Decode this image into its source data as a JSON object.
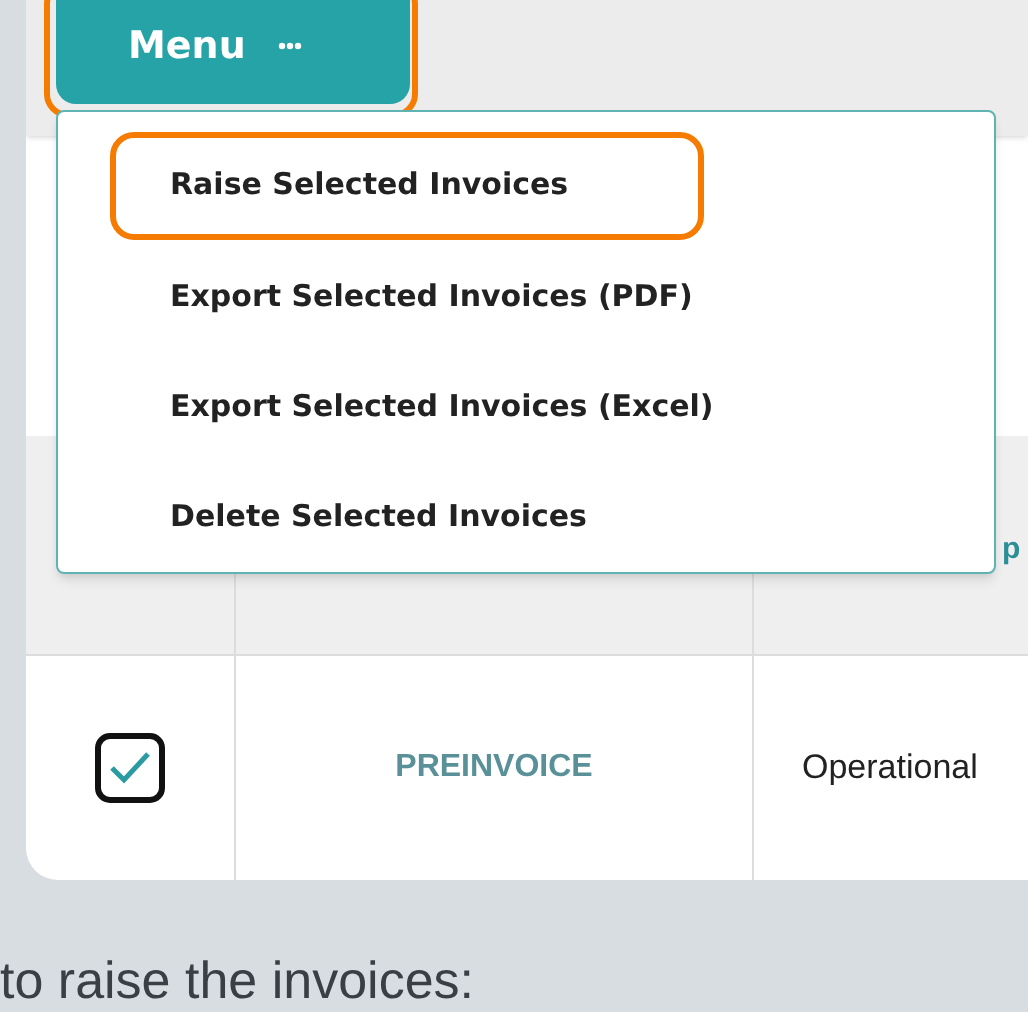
{
  "toolbar": {
    "menu_button": {
      "label": "Menu"
    }
  },
  "menu": {
    "items": [
      {
        "label": "Raise Selected Invoices",
        "highlighted": true
      },
      {
        "label": "Export Selected Invoices (PDF)",
        "highlighted": false
      },
      {
        "label": "Export Selected Invoices (Excel)",
        "highlighted": false
      },
      {
        "label": "Delete Selected Invoices",
        "highlighted": false
      }
    ]
  },
  "table": {
    "header": {
      "column_3": "p"
    },
    "rows": [
      {
        "checked": true,
        "column_2": "PREINVOICE",
        "column_3": "Operational"
      }
    ]
  },
  "caption": "to raise the invoices:"
}
